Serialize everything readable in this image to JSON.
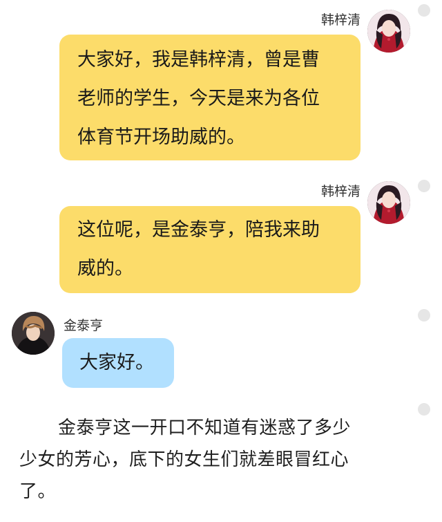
{
  "messages": [
    {
      "sender": "韩梓清",
      "lines": [
        "大家好，我是韩梓清，曾是曹",
        "老师的学生，今天是来为各位",
        "体育节开场助威的。"
      ]
    },
    {
      "sender": "韩梓清",
      "lines": [
        "这位呢，是金泰亨，陪我来助",
        "威的。"
      ]
    },
    {
      "sender": "金泰亨",
      "lines": [
        "大家好。"
      ]
    }
  ],
  "narration": {
    "lines": [
      "金泰亨这一开口不知道有迷惑了多少",
      "少女的芳心，底下的女生们就差眼冒红心",
      "了。"
    ]
  },
  "colors": {
    "right_bubble": "#fcdc6a",
    "left_bubble": "#b1e0ff",
    "dot": "#e6e6e6"
  },
  "icons": {
    "menu_dot": "more-dot-icon",
    "avatar_right": "avatar-girl-red-dress",
    "avatar_left": "avatar-boy-dark-jacket"
  }
}
